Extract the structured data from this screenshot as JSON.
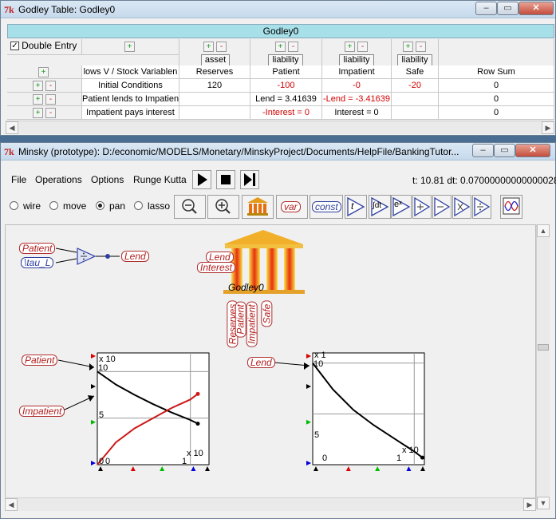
{
  "godley_window": {
    "title": "Godley Table: Godley0",
    "table_name": "Godley0",
    "double_entry_label": "Double Entry",
    "double_entry_checked": true,
    "flows_header": "lows V / Stock Variablen",
    "columns": [
      {
        "type": "asset",
        "name": "Reserves"
      },
      {
        "type": "liability",
        "name": "Patient"
      },
      {
        "type": "liability",
        "name": "Impatient"
      },
      {
        "type": "liability",
        "name": "Safe"
      }
    ],
    "row_sum_header": "Row Sum",
    "rows": [
      {
        "label": "Initial Conditions",
        "cells": [
          "120",
          "-100",
          "-0",
          "-20"
        ],
        "row_sum": "0"
      },
      {
        "label": "Patient lends to Impatient",
        "cells": [
          "",
          "Lend = 3.41639",
          "-Lend = -3.41639",
          ""
        ],
        "row_sum": "0"
      },
      {
        "label": "Impatient pays interest",
        "cells": [
          "",
          "-Interest = 0",
          "Interest = 0",
          ""
        ],
        "row_sum": "0"
      }
    ],
    "plus": "+",
    "minus": "-"
  },
  "minsky_window": {
    "title": "Minsky (prototype): D:/economic/MODELS/Monetary/MinskyProject/Documents/HelpFile/BankingTutor...",
    "menu": [
      "File",
      "Operations",
      "Options",
      "Runge Kutta"
    ],
    "status": "t: 10.81  dt: 0.07000000000000028",
    "modes": [
      {
        "label": "wire",
        "selected": false
      },
      {
        "label": "move",
        "selected": false
      },
      {
        "label": "pan",
        "selected": true
      },
      {
        "label": "lasso",
        "selected": false
      }
    ],
    "tools": {
      "var": "var",
      "const": "const",
      "time": "t",
      "integral": "∫dt",
      "exp": "eˣ"
    }
  },
  "canvas": {
    "vars": {
      "patient": "Patient",
      "tau_l": "\\tau_L",
      "lend": "Lend",
      "godley_lend": "Lend",
      "godley_interest": "Interest",
      "godley_name": "Godley0",
      "plot1_patient": "Patient",
      "plot1_impatient": "Impatient",
      "plot2_lend": "Lend"
    },
    "godley_outputs": [
      "Reserves",
      "Patient",
      "Impatient",
      "Safe"
    ]
  },
  "plot1": {
    "ytick_top": "10",
    "ytick_mid": "5",
    "ytick_zero": "0",
    "xtick_zero": "0",
    "xtick_one": "1",
    "y_multiplier": "x 10",
    "x_multiplier": "x 10"
  },
  "plot2": {
    "ytick_top": "10",
    "ytick_mid": "5",
    "ytick_zero": "0",
    "xtick_one": "1",
    "y_multiplier": "x 1",
    "x_multiplier": "x 10"
  },
  "chart_data": [
    {
      "type": "line",
      "title": "",
      "xlabel": "",
      "ylabel": "",
      "x_multiplier": "x 10",
      "xlim": [
        0,
        1.2
      ],
      "ylim": [
        0,
        12
      ],
      "grid": true,
      "series": [
        {
          "name": "Patient",
          "color": "#000000",
          "x": [
            0,
            0.2,
            0.4,
            0.6,
            0.8,
            1.0,
            1.08
          ],
          "y": [
            10.0,
            8.6,
            7.5,
            6.5,
            5.6,
            4.8,
            4.4
          ]
        },
        {
          "name": "Impatient",
          "color": "#cc1818",
          "x": [
            0,
            0.2,
            0.4,
            0.6,
            0.8,
            1.0,
            1.08
          ],
          "y": [
            0.0,
            2.4,
            3.9,
            5.0,
            6.1,
            7.0,
            7.6
          ]
        }
      ]
    },
    {
      "type": "line",
      "title": "",
      "xlabel": "",
      "ylabel": "",
      "x_multiplier": "x 10",
      "xlim": [
        0,
        1.1
      ],
      "ylim": [
        0,
        11
      ],
      "grid": true,
      "series": [
        {
          "name": "Lend",
          "color": "#000000",
          "x": [
            0,
            0.2,
            0.4,
            0.6,
            0.8,
            1.0,
            1.08
          ],
          "y": [
            10.0,
            7.4,
            5.4,
            3.9,
            2.6,
            1.3,
            0.7
          ]
        }
      ]
    }
  ],
  "colors": {
    "godley_header": "#a8e0ea",
    "titlebar": "#c6d9ec",
    "close_button": "#c44d3b",
    "variable_red": "#b21e1e",
    "variable_blue": "#2e3fa0"
  }
}
